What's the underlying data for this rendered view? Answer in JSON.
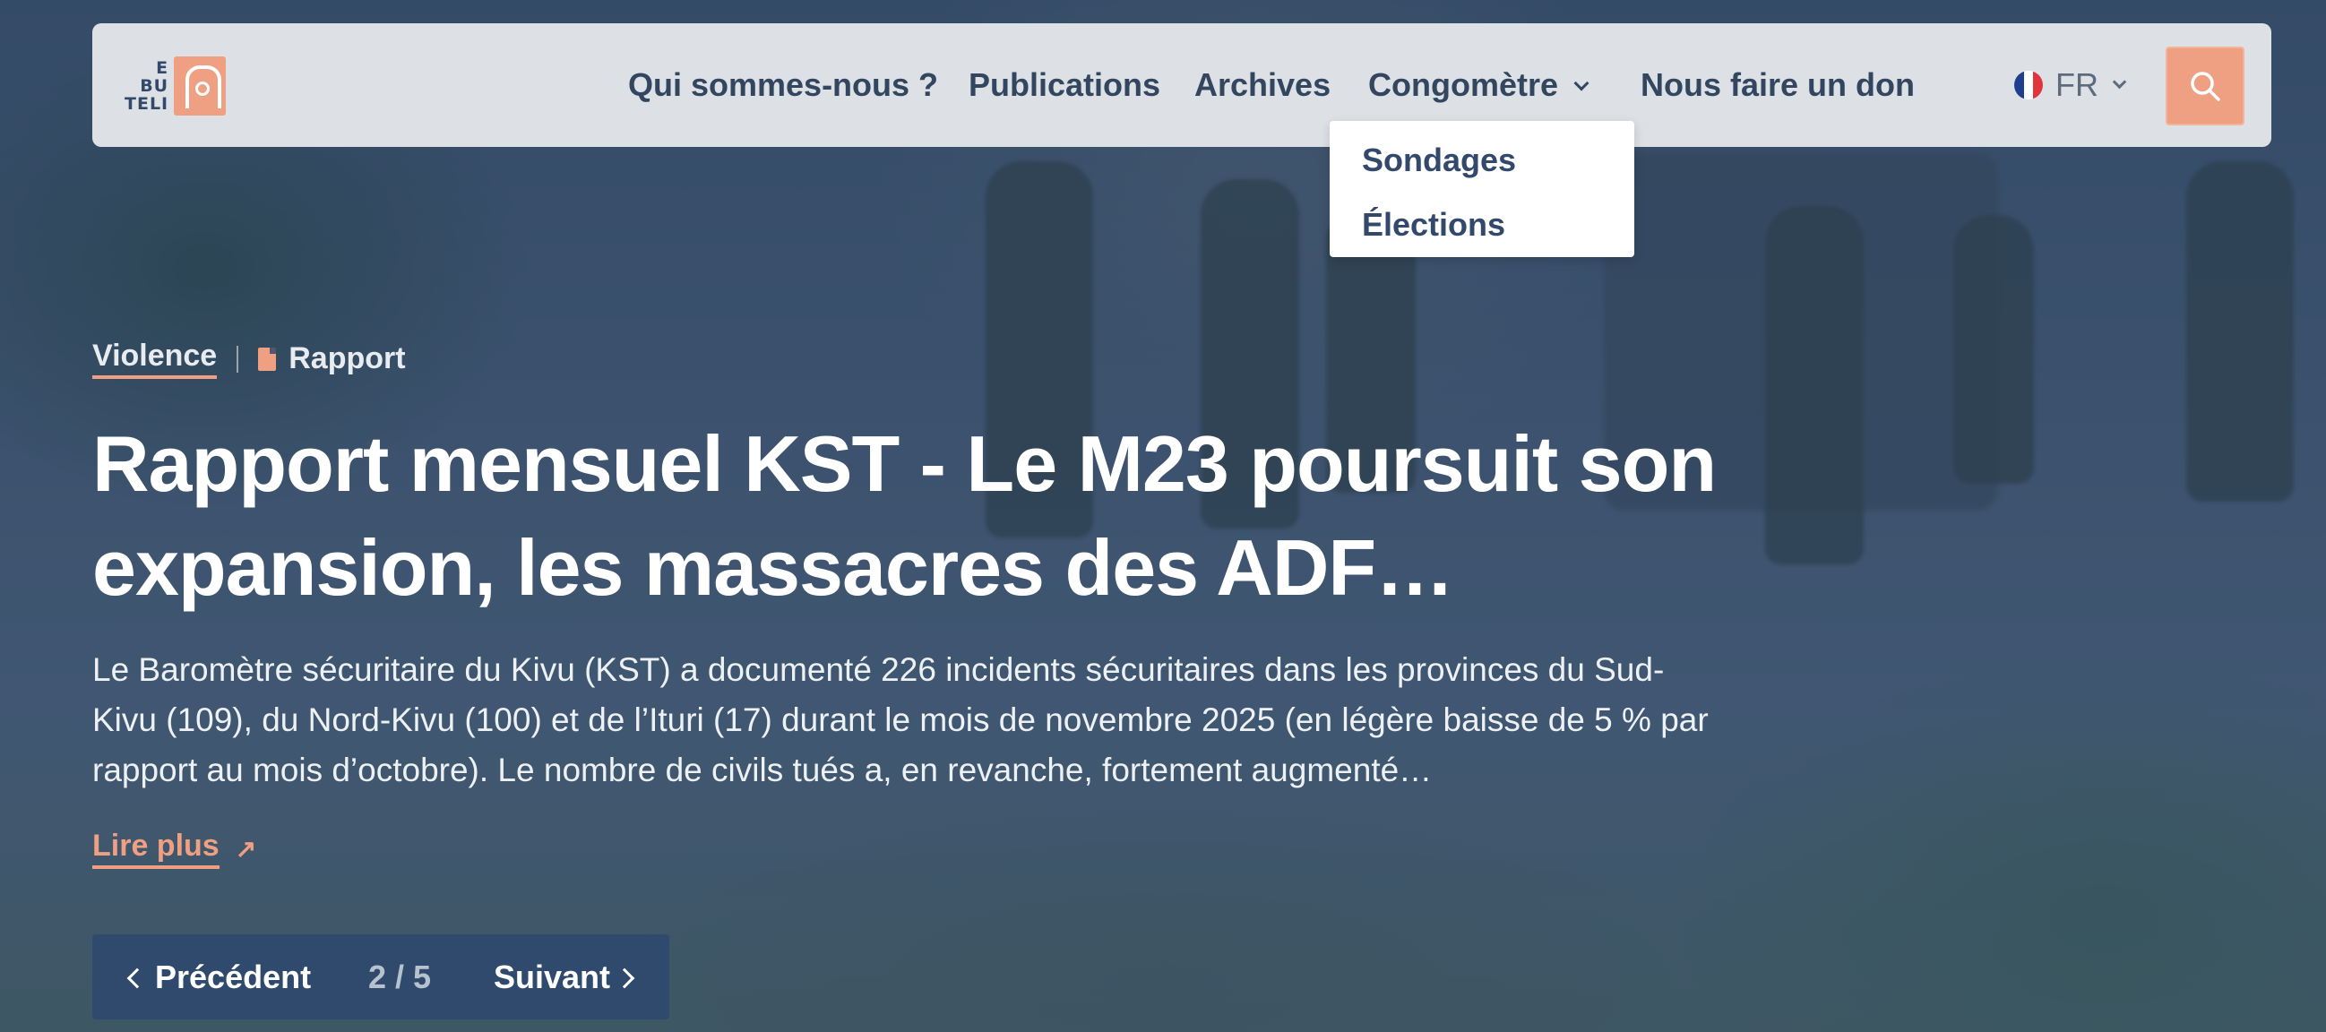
{
  "brand": {
    "logo_text": [
      "E",
      "BU",
      "TELI"
    ]
  },
  "nav": {
    "items": [
      {
        "label": "Qui sommes-nous ?"
      },
      {
        "label": "Publications"
      },
      {
        "label": "Archives"
      },
      {
        "label": "Congomètre"
      },
      {
        "label": "Nous faire un don"
      }
    ],
    "language": "FR"
  },
  "dropdown": {
    "items": [
      {
        "label": "Sondages"
      },
      {
        "label": "Élections"
      }
    ]
  },
  "article": {
    "category": "Violence",
    "type": "Rapport",
    "title": "Rapport mensuel KST - Le M23 poursuit son expansion, les massacres des ADF…",
    "summary": "Le Baromètre sécuritaire du Kivu (KST) a documenté 226 incidents sécuritaires dans les provinces du Sud-Kivu (109), du Nord-Kivu (100) et de l’Ituri (17) durant le mois de novembre 2025 (en légère baisse de 5 % par rapport au mois d’octobre). Le nombre de civils tués a, en revanche, fortement augmenté…",
    "read_more": "Lire plus"
  },
  "pager": {
    "prev": "Précédent",
    "count": "2 / 5",
    "next": "Suivant"
  },
  "colors": {
    "accent": "#ef9f82",
    "navy": "#2f4a6d",
    "nav_text": "#32475f"
  }
}
